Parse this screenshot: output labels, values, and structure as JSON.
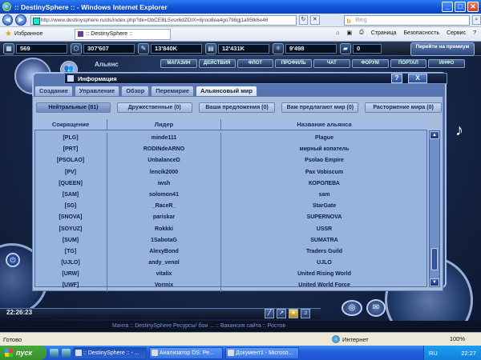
{
  "window": {
    "title": ":: DestinySphere :: - Windows Internet Explorer"
  },
  "address": {
    "url": "http://www.destinysphere.ru/ds/index.php?dk=ObCEBL5vsx6dZDIX=6jroo8ea4go798gj1a95tk6e46",
    "search_placeholder": "Bing"
  },
  "favorites": {
    "label": "Избранное",
    "tab_title": ":: DestinySphere ::",
    "commands": [
      "Страница",
      "Безопасность",
      "Сервис"
    ]
  },
  "resources": [
    {
      "icon": "box",
      "value": "569"
    },
    {
      "icon": "hex",
      "value": "307'607"
    },
    {
      "icon": "wrench",
      "value": "13'840K"
    },
    {
      "icon": "battery",
      "value": "12'431K"
    },
    {
      "icon": "atom",
      "value": "9'498"
    },
    {
      "icon": "ship",
      "value": "0"
    }
  ],
  "goprev": {
    "label": "Перейти на премиум"
  },
  "topnav": [
    "МАГАЗИН",
    "ДЕЙСТВИЯ",
    "ФЛОТ",
    "ПРОФИЛЬ",
    "ЧАТ",
    "ФОРУМ",
    "ПОРТАЛ",
    "ИНФО"
  ],
  "alliance_label": "Альянс",
  "info": {
    "title": "Информация",
    "help": "?",
    "close": "X"
  },
  "tabs": [
    {
      "label": "Создание",
      "active": false
    },
    {
      "label": "Управление",
      "active": false
    },
    {
      "label": "Обзор",
      "active": false
    },
    {
      "label": "Перемирие",
      "active": false
    },
    {
      "label": "Альянсовый мир",
      "active": true
    }
  ],
  "subtabs": [
    {
      "label": "Нейтральные (81)",
      "active": true
    },
    {
      "label": "Дружественные (0)",
      "active": false
    },
    {
      "label": "Ваши предложения (0)",
      "active": false
    },
    {
      "label": "Вам предлагают мир (0)",
      "active": false
    },
    {
      "label": "Расторжение мира (0)",
      "active": false
    }
  ],
  "table": {
    "headers": [
      "Сокращение",
      "Лидер",
      "Название альянса"
    ],
    "rows": [
      [
        "[PLG]",
        "minde111",
        "Plague"
      ],
      [
        "[PRT]",
        "RODINdeARNO",
        "мирный копатель"
      ],
      [
        "[PSOLAO]",
        "UnbalanceD",
        "Psolao Empire"
      ],
      [
        "[PV]",
        "lencik2000",
        "Pax Vobiscum"
      ],
      [
        "[QUEEN]",
        "iwsh",
        "КОРОЛЕВА"
      ],
      [
        "[SAM]",
        "solomon41",
        "sam"
      ],
      [
        "[SG]",
        "_RaceR_",
        "StarGate"
      ],
      [
        "[SNOVA]",
        "pariskar",
        "SUPERNOVA"
      ],
      [
        "[SOYUZ]",
        "Rokkki",
        "USSR"
      ],
      [
        "[SUM]",
        "1SabotaG",
        "SUMATRA"
      ],
      [
        "[TG]",
        "AlexyBond",
        "Traders Guild"
      ],
      [
        "[UJLO]",
        "andy_venol",
        "UJLO"
      ],
      [
        "[URW]",
        "vitalix",
        "United Rising World"
      ],
      [
        "[UWF]",
        "Vormix",
        "United World Force"
      ]
    ]
  },
  "clock": "22:26:23",
  "ticker": "Мачта :: DestinySphere Ресурсы/ бои ... :: Вакансия сайта :: Ростов",
  "status": {
    "text": "Готово",
    "zone": "Интернет",
    "zoom": "100%"
  },
  "taskbar": {
    "start": "пуск",
    "tasks": [
      ":: DestinySphere :: - ...",
      "Анализатор DS: Ре...",
      "Документ1 - Microso..."
    ],
    "lang": "RU",
    "time": "22:27"
  }
}
